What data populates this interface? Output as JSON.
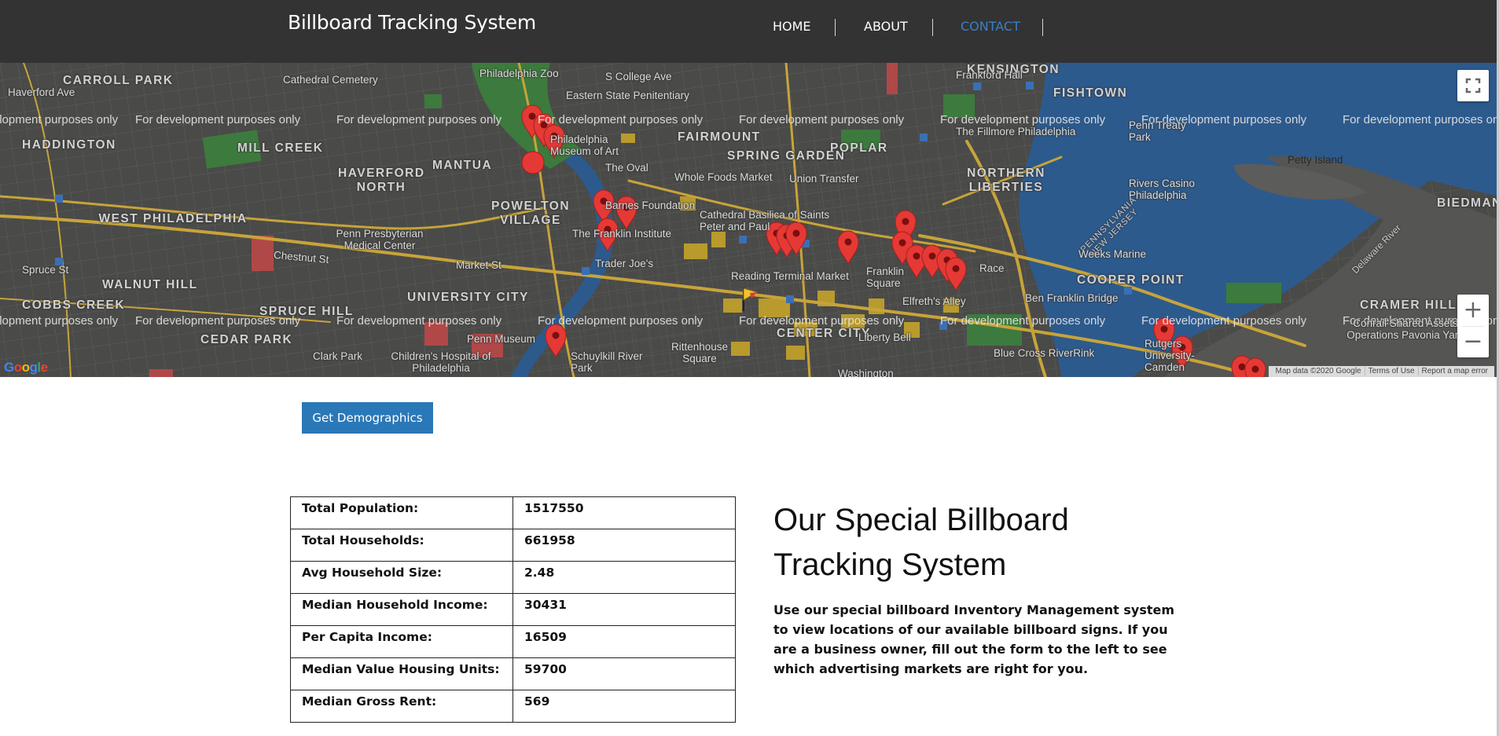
{
  "header": {
    "brand": "Billboard Tracking System",
    "nav": [
      {
        "label": "HOME"
      },
      {
        "label": "ABOUT"
      },
      {
        "label": "CONTACT",
        "active": true
      }
    ],
    "background_color": "#333333",
    "active_color": "#3a7fc7"
  },
  "map": {
    "dev_watermark": "For development purposes only",
    "places": {
      "carroll_park": "CARROLL PARK",
      "haverford_ave": "Haverford Ave",
      "haddington": "HADDINGTON",
      "mill_creek": "MILL CREEK",
      "haverford_north": "HAVERFORD NORTH",
      "mantua": "MANTUA",
      "powelton_village": "POWELTON VILLAGE",
      "west_philadelphia": "WEST PHILADELPHIA",
      "walnut_hill": "WALNUT HILL",
      "cobbs_creek": "COBBS CREEK",
      "cedar_park": "CEDAR PARK",
      "spruce_hill": "SPRUCE HILL",
      "university_city": "UNIVERSITY CITY",
      "fairmount": "FAIRMOUNT",
      "spring_garden": "SPRING GARDEN",
      "poplar": "POPLAR",
      "kensington": "KENSINGTON",
      "fishtown": "FISHTOWN",
      "northern_liberties": "NORTHERN LIBERTIES",
      "center_city": "CENTER CITY",
      "cooper_point": "COOPER POINT",
      "cramer_hill": "CRAMER HILL",
      "biedman": "BIEDMAN",
      "philadelphia_zoo": "Philadelphia Zoo",
      "cathedral_cemetery": "Cathedral Cemetery",
      "eastern_state": "Eastern State Penitentiary",
      "museum_of_art": "Philadelphia Museum of Art",
      "the_oval": "The Oval",
      "whole_foods": "Whole Foods Market",
      "union_transfer": "Union Transfer",
      "barnes": "Barnes Foundation",
      "franklin_institute": "The Franklin Institute",
      "cathedral_basilica": "Cathedral Basilica of Saints Peter and Paul",
      "penn_presbyterian": "Penn Presbyterian Medical Center",
      "trader_joes": "Trader Joe's",
      "reading_terminal": "Reading Terminal Market",
      "franklin_square": "Franklin Square",
      "elfreths_alley": "Elfreth's Alley",
      "race_street": "Race",
      "liberty_bell": "Liberty Bell",
      "penn_museum": "Penn Museum",
      "clark_park": "Clark Park",
      "childrens_hospital": "Children's Hospital of Philadelphia",
      "schuylkill_river_park": "Schuylkill River Park",
      "rittenhouse_square": "Rittenhouse Square",
      "washington": "Washington",
      "blue_cross": "Blue Cross RiverRink",
      "ben_franklin_bridge": "Ben Franklin Bridge",
      "penn_treaty_park": "Penn Treaty Park",
      "rivers_casino": "Rivers Casino Philadelphia",
      "petty_island": "Petty Island",
      "delaware_river": "Delaware River",
      "pennsylvania_nj": "PENNSYLVANIA NEW JERSEY",
      "westmont_marine": "Weeks Marine",
      "conrail": "Conrail Shared Assets Operations Pavonia Yard",
      "frankford_hall": "Frankford Hall",
      "fillmore": "The Fillmore Philadelphia",
      "chestnut_st": "Chestnut St",
      "market_st": "Market St",
      "spruce_st": "Spruce St",
      "s_college_ave": "S College Ave",
      "rutgers": "Rutgers University-Camden"
    },
    "controls": {
      "zoom_in": "+",
      "zoom_out": "−",
      "fullscreen_icon": "fullscreen-icon"
    },
    "attribution": {
      "map_data": "Map data ©2020 Google",
      "terms": "Terms of Use",
      "report": "Report a map error"
    },
    "logo": "Google",
    "marker_color": "#e53935",
    "water_color": "#2d5a8c",
    "park_color": "#3d8a3d"
  },
  "demographics_button": "Get Demographics",
  "stats": [
    {
      "label": "Total Population:",
      "value": "1517550"
    },
    {
      "label": "Total Households:",
      "value": "661958"
    },
    {
      "label": "Avg Household Size:",
      "value": "2.48"
    },
    {
      "label": "Median Household Income:",
      "value": "30431"
    },
    {
      "label": "Per Capita Income:",
      "value": "16509"
    },
    {
      "label": "Median Value Housing Units:",
      "value": "59700"
    },
    {
      "label": "Median Gross Rent:",
      "value": "569"
    }
  ],
  "promo": {
    "headline": "Our Special Billboard Tracking System",
    "body": "Use our special billboard Inventory Management system to view locations of our available billboard signs. If you are a business owner, fill out the form to the left to see which advertising markets are right for you."
  }
}
